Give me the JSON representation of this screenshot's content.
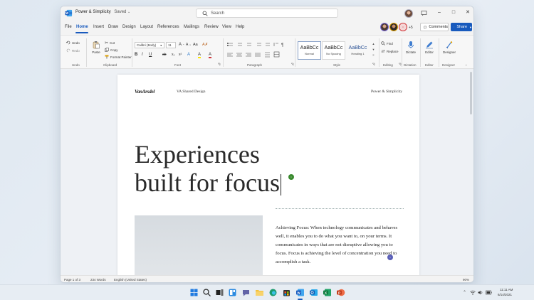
{
  "window": {
    "doc_title": "Power & Simplicity",
    "saved_status": "Saved",
    "search_placeholder": "Search"
  },
  "menu": {
    "tabs": [
      "File",
      "Home",
      "Insert",
      "Draw",
      "Design",
      "Layout",
      "References",
      "Mailings",
      "Review",
      "View",
      "Help"
    ],
    "active_tab": "Home",
    "collaborators_more": "+5",
    "comments_label": "Comments",
    "share_label": "Share"
  },
  "ribbon": {
    "undo": {
      "undo": "Undo",
      "redo": "Redo",
      "group": "Undo"
    },
    "clipboard": {
      "paste": "Paste",
      "cut": "Cut",
      "copy": "Copy",
      "format_painter": "Format Painter",
      "group": "Clipboard"
    },
    "font": {
      "font_name": "Calibri (Body)",
      "font_size": "11",
      "group": "Font",
      "format_buttons": [
        "B",
        "I",
        "U",
        "ab",
        "x₂",
        "x²",
        "A",
        "A",
        "A"
      ]
    },
    "paragraph": {
      "group": "Paragraph"
    },
    "styles": {
      "group": "Style",
      "items": [
        {
          "sample": "AaBbCc",
          "name": "Normal"
        },
        {
          "sample": "AaBbCc",
          "name": "No Spacing"
        },
        {
          "sample": "AaBbCc",
          "name": "Heading 1"
        }
      ]
    },
    "editing": {
      "find": "Find",
      "replace": "Replace",
      "group": "Editing"
    },
    "dictate": {
      "label": "Dictate",
      "group": "Dictation"
    },
    "editor": {
      "label": "Editor",
      "group": "Editor"
    },
    "designer": {
      "label": "Designer",
      "group": "Designer"
    }
  },
  "document": {
    "brand": "VanArsdel",
    "header_mid": "VA Shared Design",
    "header_right": "Power & Simplicity",
    "headline_line1": "Experiences",
    "headline_line2": "built for focus",
    "body": "Achieving Focus: When technology communicates and behaves well, it enables you to do what you want to, on your terms. It communicates in ways that are not disruptive allowing you to focus. Focus is achieving the level of concentration you need to accomplish a task."
  },
  "statusbar": {
    "page": "Page 1 of 3",
    "words": "234 Words",
    "language": "English (United States)",
    "zoom": "90%"
  },
  "taskbar": {
    "time": "11:11 AM",
    "date": "6/14/2021"
  },
  "colors": {
    "accent": "#185abd",
    "presence_green": "#3a8a2f",
    "presence_purple": "#5a5fb8"
  }
}
